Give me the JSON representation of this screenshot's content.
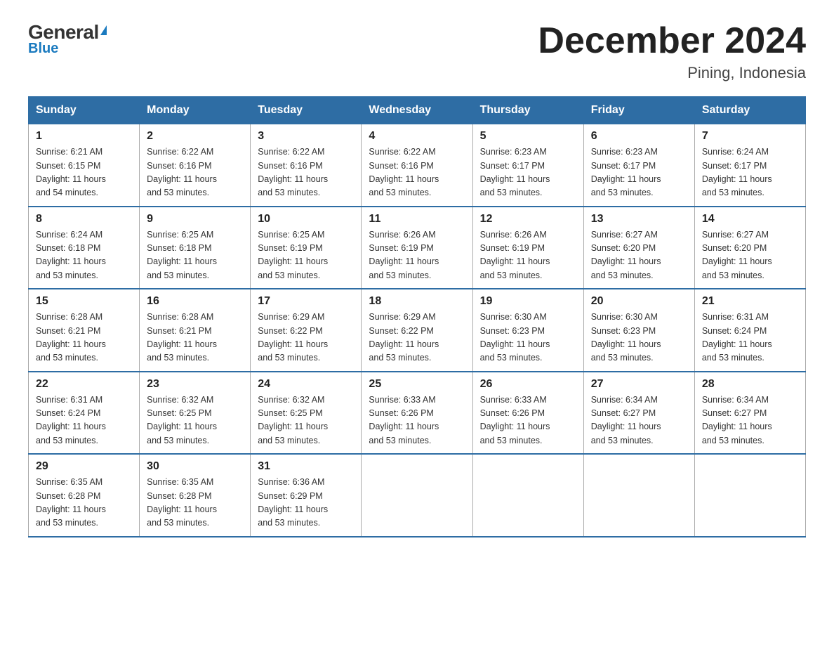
{
  "logo": {
    "general": "General",
    "triangle": "▶",
    "blue": "Blue"
  },
  "title": "December 2024",
  "subtitle": "Pining, Indonesia",
  "days_of_week": [
    "Sunday",
    "Monday",
    "Tuesday",
    "Wednesday",
    "Thursday",
    "Friday",
    "Saturday"
  ],
  "weeks": [
    [
      {
        "day": "1",
        "sunrise": "6:21 AM",
        "sunset": "6:15 PM",
        "daylight": "11 hours and 54 minutes."
      },
      {
        "day": "2",
        "sunrise": "6:22 AM",
        "sunset": "6:16 PM",
        "daylight": "11 hours and 53 minutes."
      },
      {
        "day": "3",
        "sunrise": "6:22 AM",
        "sunset": "6:16 PM",
        "daylight": "11 hours and 53 minutes."
      },
      {
        "day": "4",
        "sunrise": "6:22 AM",
        "sunset": "6:16 PM",
        "daylight": "11 hours and 53 minutes."
      },
      {
        "day": "5",
        "sunrise": "6:23 AM",
        "sunset": "6:17 PM",
        "daylight": "11 hours and 53 minutes."
      },
      {
        "day": "6",
        "sunrise": "6:23 AM",
        "sunset": "6:17 PM",
        "daylight": "11 hours and 53 minutes."
      },
      {
        "day": "7",
        "sunrise": "6:24 AM",
        "sunset": "6:17 PM",
        "daylight": "11 hours and 53 minutes."
      }
    ],
    [
      {
        "day": "8",
        "sunrise": "6:24 AM",
        "sunset": "6:18 PM",
        "daylight": "11 hours and 53 minutes."
      },
      {
        "day": "9",
        "sunrise": "6:25 AM",
        "sunset": "6:18 PM",
        "daylight": "11 hours and 53 minutes."
      },
      {
        "day": "10",
        "sunrise": "6:25 AM",
        "sunset": "6:19 PM",
        "daylight": "11 hours and 53 minutes."
      },
      {
        "day": "11",
        "sunrise": "6:26 AM",
        "sunset": "6:19 PM",
        "daylight": "11 hours and 53 minutes."
      },
      {
        "day": "12",
        "sunrise": "6:26 AM",
        "sunset": "6:19 PM",
        "daylight": "11 hours and 53 minutes."
      },
      {
        "day": "13",
        "sunrise": "6:27 AM",
        "sunset": "6:20 PM",
        "daylight": "11 hours and 53 minutes."
      },
      {
        "day": "14",
        "sunrise": "6:27 AM",
        "sunset": "6:20 PM",
        "daylight": "11 hours and 53 minutes."
      }
    ],
    [
      {
        "day": "15",
        "sunrise": "6:28 AM",
        "sunset": "6:21 PM",
        "daylight": "11 hours and 53 minutes."
      },
      {
        "day": "16",
        "sunrise": "6:28 AM",
        "sunset": "6:21 PM",
        "daylight": "11 hours and 53 minutes."
      },
      {
        "day": "17",
        "sunrise": "6:29 AM",
        "sunset": "6:22 PM",
        "daylight": "11 hours and 53 minutes."
      },
      {
        "day": "18",
        "sunrise": "6:29 AM",
        "sunset": "6:22 PM",
        "daylight": "11 hours and 53 minutes."
      },
      {
        "day": "19",
        "sunrise": "6:30 AM",
        "sunset": "6:23 PM",
        "daylight": "11 hours and 53 minutes."
      },
      {
        "day": "20",
        "sunrise": "6:30 AM",
        "sunset": "6:23 PM",
        "daylight": "11 hours and 53 minutes."
      },
      {
        "day": "21",
        "sunrise": "6:31 AM",
        "sunset": "6:24 PM",
        "daylight": "11 hours and 53 minutes."
      }
    ],
    [
      {
        "day": "22",
        "sunrise": "6:31 AM",
        "sunset": "6:24 PM",
        "daylight": "11 hours and 53 minutes."
      },
      {
        "day": "23",
        "sunrise": "6:32 AM",
        "sunset": "6:25 PM",
        "daylight": "11 hours and 53 minutes."
      },
      {
        "day": "24",
        "sunrise": "6:32 AM",
        "sunset": "6:25 PM",
        "daylight": "11 hours and 53 minutes."
      },
      {
        "day": "25",
        "sunrise": "6:33 AM",
        "sunset": "6:26 PM",
        "daylight": "11 hours and 53 minutes."
      },
      {
        "day": "26",
        "sunrise": "6:33 AM",
        "sunset": "6:26 PM",
        "daylight": "11 hours and 53 minutes."
      },
      {
        "day": "27",
        "sunrise": "6:34 AM",
        "sunset": "6:27 PM",
        "daylight": "11 hours and 53 minutes."
      },
      {
        "day": "28",
        "sunrise": "6:34 AM",
        "sunset": "6:27 PM",
        "daylight": "11 hours and 53 minutes."
      }
    ],
    [
      {
        "day": "29",
        "sunrise": "6:35 AM",
        "sunset": "6:28 PM",
        "daylight": "11 hours and 53 minutes."
      },
      {
        "day": "30",
        "sunrise": "6:35 AM",
        "sunset": "6:28 PM",
        "daylight": "11 hours and 53 minutes."
      },
      {
        "day": "31",
        "sunrise": "6:36 AM",
        "sunset": "6:29 PM",
        "daylight": "11 hours and 53 minutes."
      },
      null,
      null,
      null,
      null
    ]
  ],
  "labels": {
    "sunrise": "Sunrise:",
    "sunset": "Sunset:",
    "daylight": "Daylight:"
  }
}
